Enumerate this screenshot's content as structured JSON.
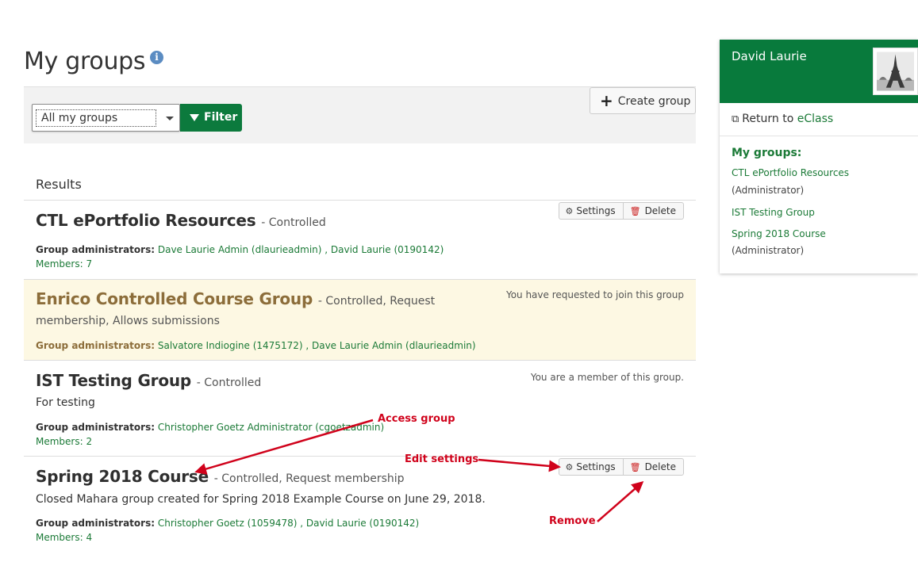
{
  "page": {
    "title": "My groups",
    "info_icon": "info-icon"
  },
  "filter": {
    "selected": "All my groups",
    "filter_label": "Filter",
    "create_label": "Create group"
  },
  "results_label": "Results",
  "groups": [
    {
      "name": "CTL ePortfolio Resources",
      "type": "- Controlled",
      "admins_label": "Group administrators:",
      "admins": "Dave Laurie Admin (dlaurieadmin) , David Laurie (0190142)",
      "members": "Members: 7",
      "settings_label": "Settings",
      "delete_label": "Delete"
    },
    {
      "name": "Enrico Controlled Course Group",
      "type": "- Controlled, Request",
      "type_cont": "membership, Allows submissions",
      "status": "You have requested to join this group",
      "admins_label": "Group administrators:",
      "admins": "Salvatore Indiogine (1475172) , Dave Laurie Admin (dlaurieadmin)"
    },
    {
      "name": "IST Testing Group",
      "type": "- Controlled",
      "description": "For testing",
      "status": "You are a member of this group.",
      "admins_label": "Group administrators:",
      "admins": "Christopher Goetz Administrator (cgoetzadmin)",
      "members": "Members: 2"
    },
    {
      "name": "Spring 2018 Course",
      "type": "- Controlled, Request membership",
      "description": "Closed Mahara group created for Spring 2018 Example Course on June 29, 2018.",
      "admins_label": "Group administrators:",
      "admins": "Christopher Goetz (1059478) , David Laurie (0190142)",
      "members": "Members: 4",
      "settings_label": "Settings",
      "delete_label": "Delete"
    }
  ],
  "sidebar": {
    "user_name": "David Laurie",
    "return_prefix": "Return to ",
    "return_link": "eClass",
    "heading": "My groups:",
    "items": [
      {
        "name": "CTL ePortfolio Resources",
        "role": "(Administrator)"
      },
      {
        "name": "IST Testing Group"
      },
      {
        "name": "Spring 2018 Course",
        "role": "(Administrator)"
      }
    ]
  },
  "annotations": {
    "access": "Access group",
    "edit": "Edit settings",
    "remove": "Remove",
    "color": "#d0021b"
  },
  "colors": {
    "brand_green": "#087a3c",
    "link_green": "#1b7a37",
    "pending_bg": "#fdf8e3",
    "pending_title": "#8c6d3a"
  }
}
